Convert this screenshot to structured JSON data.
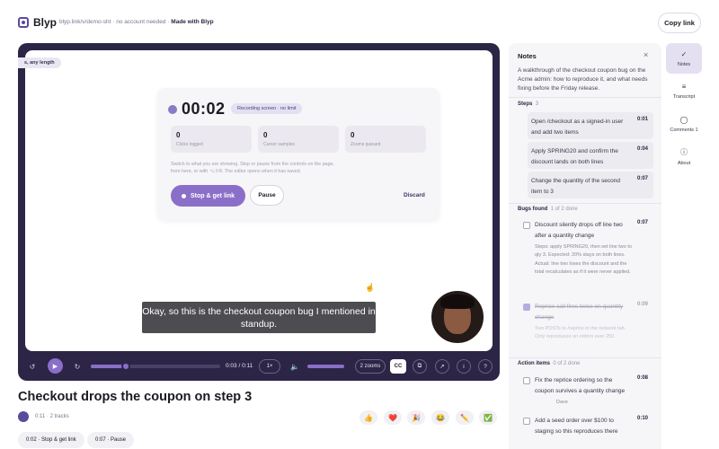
{
  "header": {
    "brand": "Blyp",
    "url_prefix": "blyp.link/v/demo-sht · no account needed · ",
    "url_highlight": "Made with Blyp",
    "copy_link": "Copy link"
  },
  "recording": {
    "chip_any_length": "s, any length",
    "timer": "00:02",
    "badge": "Recording screen · no limit",
    "stats": [
      {
        "value": "0",
        "label": "Clicks logged"
      },
      {
        "value": "0",
        "label": "Cursor samples"
      },
      {
        "value": "0",
        "label": "Zooms queued"
      }
    ],
    "help_text": "Switch to what you are showing. Stop or pause from the controls on the page, from here, or with ⌥⇧R. The editor opens when it has saved.",
    "stop_label": "Stop & get link",
    "pause_label": "Pause",
    "discard_label": "Discard"
  },
  "subtitle": "Okay, so this is the checkout coupon bug I mentioned in standup.",
  "controls": {
    "time": "0:03 / 0:11",
    "speed": "1×",
    "zooms": "2 zooms",
    "cc": "CC",
    "play_progress": 0.27
  },
  "video": {
    "title": "Checkout drops the coupon on step 3",
    "meta": "0:11 · 2 tracks",
    "reactions": [
      "👍",
      "❤️",
      "🎉",
      "😂",
      "✏️",
      "✅"
    ],
    "chapters": [
      "0:02 · Stop & get link",
      "0:07 · Pause"
    ]
  },
  "notes": {
    "title": "Notes",
    "description": "A walkthrough of the checkout coupon bug on the Acme admin: how to reproduce it, and what needs fixing before the Friday release.",
    "steps_label": "Steps",
    "steps_count": "3",
    "steps": [
      {
        "text": "Open /checkout as a signed-in user and add two items",
        "time": "0:01"
      },
      {
        "text": "Apply SPRING20 and confirm the discount lands on both lines",
        "time": "0:04"
      },
      {
        "text": "Change the quantity of the second item to 3",
        "time": "0:07"
      }
    ],
    "bugs_label": "Bugs found",
    "bugs_count": "1 of 2 done",
    "bugs": [
      {
        "text": "Discount silently drops off line two after a quantity change",
        "time": "0:07",
        "detail": "Steps: apply SPRING20, then set line two to qty 3. Expected: 20% stays on both lines. Actual: line two loses the discount and the total recalculates as if it were never applied.",
        "done": false
      },
      {
        "text": "Reprice call fires twice on quantity change",
        "time": "0:09",
        "detail": "Two POSTs to /reprice in the network tab. Only reproduces on orders over 250.",
        "done": true
      }
    ],
    "actions_label": "Action items",
    "actions_count": "0 of 2 done",
    "actions": [
      {
        "text": "Fix the reprice ordering so the coupon survives a quantity change",
        "owner": "Dave",
        "time": "0:08"
      },
      {
        "text": "Add a seed order over $100 to staging so this reproduces there",
        "time": "0:10"
      }
    ]
  },
  "side_tabs": [
    {
      "label": "Notes",
      "icon": "✓"
    },
    {
      "label": "Transcript",
      "icon": "≡"
    },
    {
      "label": "Comments 1",
      "icon": "◯"
    },
    {
      "label": "About",
      "icon": "ⓘ"
    }
  ],
  "colors": {
    "accent": "#8a6fc9",
    "frame": "#2d2546",
    "panel": "#f6f5f8"
  }
}
